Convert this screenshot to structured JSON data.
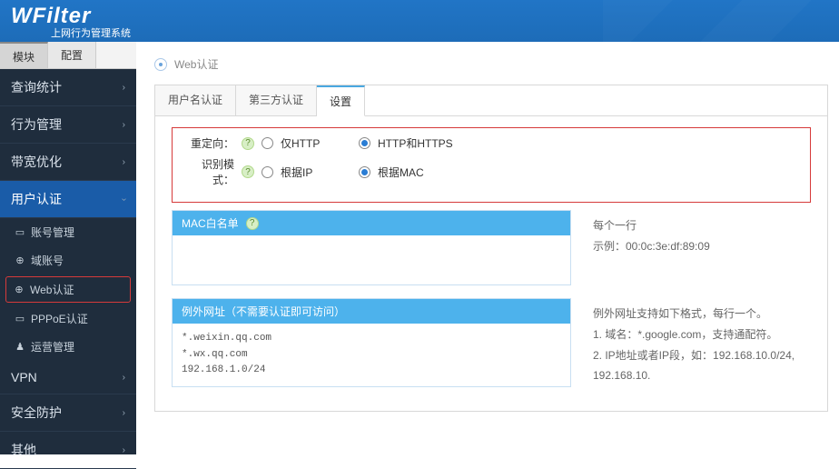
{
  "header": {
    "title": "WFilter",
    "subtitle": "上网行为管理系统"
  },
  "topTabs": {
    "modules": "模块",
    "config": "配置"
  },
  "nav": {
    "items": [
      {
        "label": "查询统计"
      },
      {
        "label": "行为管理"
      },
      {
        "label": "带宽优化"
      },
      {
        "label": "用户认证",
        "active": true
      },
      {
        "label": "VPN"
      },
      {
        "label": "安全防护"
      },
      {
        "label": "其他"
      }
    ],
    "sub": {
      "acct": "账号管理",
      "domain": "域账号",
      "web": "Web认证",
      "pppoe": "PPPoE认证",
      "ops": "运营管理"
    }
  },
  "crumb": "Web认证",
  "tabs": {
    "t1": "用户名认证",
    "t2": "第三方认证",
    "t3": "设置"
  },
  "form": {
    "redirect": {
      "label": "重定向：",
      "opt1": "仅HTTP",
      "opt2": "HTTP和HTTPS"
    },
    "mode": {
      "label": "识别模式：",
      "opt1": "根据IP",
      "opt2": "根据MAC"
    }
  },
  "box1": {
    "title": "MAC白名单"
  },
  "help1": {
    "line1": "每个一行",
    "line2": "示例：00:0c:3e:df:89:09"
  },
  "box2": {
    "title": "例外网址（不需要认证即可访问）",
    "l1": "*.weixin.qq.com",
    "l2": "*.wx.qq.com",
    "l3": "192.168.1.0/24"
  },
  "help2": {
    "line1": "例外网址支持如下格式，每行一个。",
    "line2": "1. 域名：*.google.com，支持通配符。",
    "line3": "2. IP地址或者IP段，如：192.168.10.0/24, 192.168.10."
  }
}
